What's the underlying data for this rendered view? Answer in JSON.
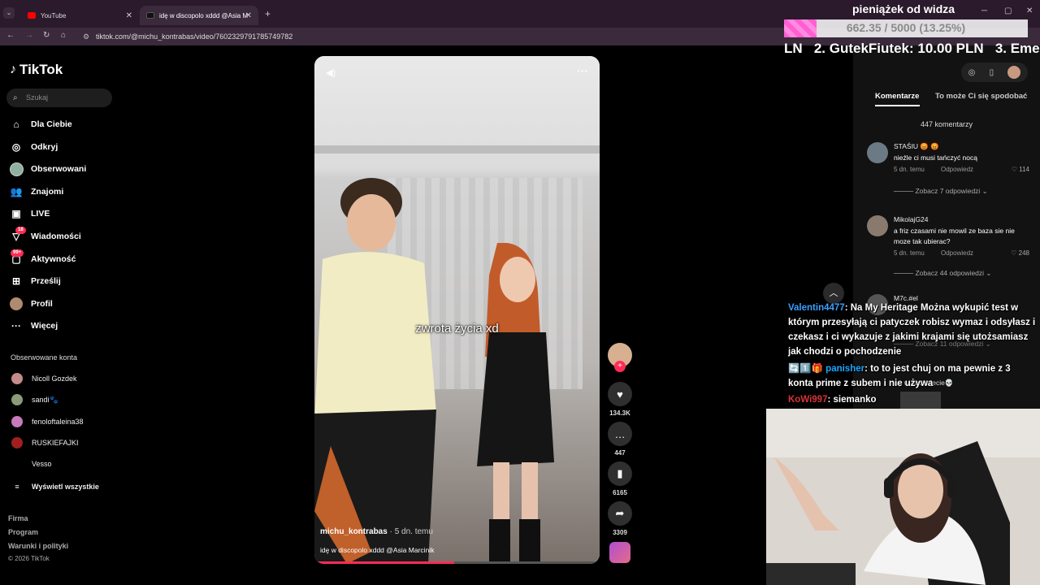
{
  "browser": {
    "tabs": [
      {
        "label": "YouTube",
        "active": false
      },
      {
        "label": "idę w discopolo xddd @Asia M",
        "active": true
      }
    ],
    "url": "tiktok.com/@michu_kontrabas/video/7602329791785749782"
  },
  "sidebar": {
    "logo": "TikTok",
    "search_placeholder": "Szukaj",
    "nav": [
      {
        "label": "Dla Ciebie",
        "icon": "home-icon"
      },
      {
        "label": "Odkryj",
        "icon": "compass-icon"
      },
      {
        "label": "Obserwowani",
        "icon": "avatar-icon"
      },
      {
        "label": "Znajomi",
        "icon": "people-icon"
      },
      {
        "label": "LIVE",
        "icon": "live-icon"
      },
      {
        "label": "Wiadomości",
        "icon": "message-icon",
        "badge": "18"
      },
      {
        "label": "Aktywność",
        "icon": "activity-icon",
        "badge": "99+"
      },
      {
        "label": "Prześlij",
        "icon": "upload-icon"
      },
      {
        "label": "Profil",
        "icon": "profile-icon"
      },
      {
        "label": "Więcej",
        "icon": "more-icon"
      }
    ],
    "followed_title": "Obserwowane konta",
    "followed": [
      {
        "name": "Nicoll Gozdek",
        "color": "#c58b8b"
      },
      {
        "name": "sandi🐾",
        "color": "#8a9a7a"
      },
      {
        "name": "fenoloftaleina38",
        "color": "#c77bbd"
      },
      {
        "name": "RUSKIEFAJKI",
        "color": "#a02020"
      },
      {
        "name": "Vesso",
        "color": ""
      }
    ],
    "show_all": "Wyświetl wszystkie",
    "footer": [
      "Firma",
      "Program",
      "Warunki i polityki"
    ],
    "copyright": "© 2026 TikTok"
  },
  "video": {
    "subtitle": "zwrota życia xd",
    "author": "michu_kontrabas",
    "when": "· 5 dn. temu",
    "description": "idę w discopolo xddd @Asia Marcinik",
    "progress": 0.49
  },
  "actions": {
    "likes": "134.3K",
    "comments": "447",
    "saves": "6165",
    "shares": "3309"
  },
  "overlay": {
    "title": "pieniążek od widza",
    "goal_text": "662.35 / 5000 (13.25%)",
    "goal_fraction": 0.1325,
    "ticker_prefix": "LN",
    "ticker_item": "2. GutekFiutek: 10.00 PLN",
    "ticker_next": "3. Eme"
  },
  "panel": {
    "tabs": [
      "Komentarze",
      "To może Ci się spodobać"
    ],
    "comment_count": "447 komentarzy",
    "comments": [
      {
        "user": "STAŚIU 😡 😡",
        "text": "nieźle ci musi tańczyć nocą",
        "when": "5 dn. temu",
        "reply": "Odpowiedz",
        "likes": "114",
        "more": "Zobacz 7 odpowiedzi"
      },
      {
        "user": "MikolajG24",
        "text": "a friz czasami nie mowil ze baza sie nie moze tak ubierac?",
        "when": "5 dn. temu",
        "reply": "Odpowiedz",
        "likes": "248",
        "more": "Zobacz 44 odpowiedzi"
      },
      {
        "user": "M7c.#el",
        "text": "",
        "when": "",
        "reply": "",
        "likes": "",
        "more": "Zobacz 11 odpowiedzi"
      }
    ],
    "partial_text": "wy wyszukujecie💀"
  },
  "chat": [
    {
      "name": "Valentin4477",
      "name_color": "#3aa0ff",
      "text": ": Na My Heritage Można wykupić test w którym przesyłają ci patyczek robisz wymaz i odsyłasz i czekasz i ci wykazuje z jakimi krajami się utożsamiasz jak chodzi o pochodzenie"
    },
    {
      "name": "panisher",
      "name_color": "#1aa7ff",
      "prefix": "🔄1️⃣🎁",
      "text": ": to to jest chuj on ma pewnie z 3 konta prime z subem i nie używa"
    },
    {
      "name": "KoWi997",
      "name_color": "#d4343a",
      "text": ": siemanko"
    }
  ]
}
